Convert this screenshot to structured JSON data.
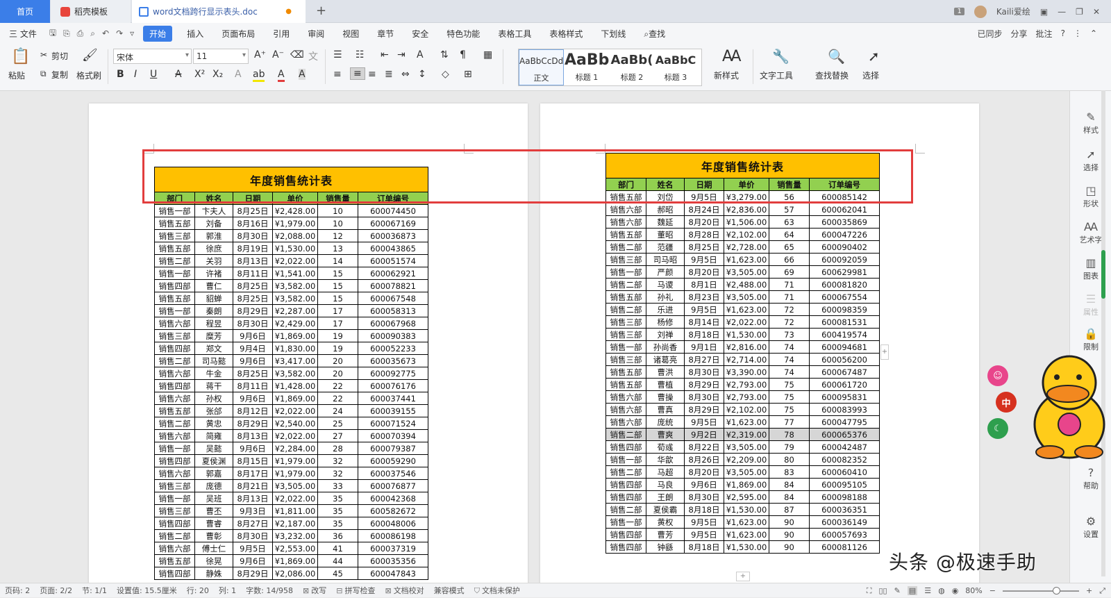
{
  "tabs": {
    "home": "首页",
    "templates": "稻壳模板",
    "doc": "word文档跨行显示表头.doc",
    "new_tab": "+",
    "badge": "1",
    "user": "Kaili爱绘"
  },
  "menu": {
    "file": "三 文件",
    "items": [
      "开始",
      "插入",
      "页面布局",
      "引用",
      "审阅",
      "视图",
      "章节",
      "安全",
      "特色功能",
      "表格工具",
      "表格样式",
      "下划线"
    ],
    "search": "查找",
    "right": [
      "已同步",
      "分享",
      "批注",
      "?"
    ]
  },
  "ribbon": {
    "paste": "粘贴",
    "cut": "剪切",
    "copy": "复制",
    "format_painter": "格式刷",
    "font_name": "宋体",
    "font_size": "11",
    "styles": [
      {
        "preview": "AaBbCcDd",
        "name": "正文"
      },
      {
        "preview": "AaBb",
        "name": "标题 1"
      },
      {
        "preview": "AaBb(",
        "name": "标题 2"
      },
      {
        "preview": "AaBbC",
        "name": "标题 3"
      }
    ],
    "new_style": "新样式",
    "text_tools": "文字工具",
    "find_replace": "查找替换",
    "select": "选择"
  },
  "right_panel": [
    "样式",
    "选择",
    "形状",
    "艺术字",
    "图表",
    "属性",
    "限制",
    "帮助",
    "设置"
  ],
  "table": {
    "title": "年度销售统计表",
    "headers": [
      "部门",
      "姓名",
      "日期",
      "单价",
      "销售量",
      "订单编号"
    ]
  },
  "left_rows": [
    [
      "销售一部",
      "卞夫人",
      "8月25日",
      "¥2,428.00",
      "10",
      "600074450"
    ],
    [
      "销售五部",
      "刘备",
      "8月16日",
      "¥1,979.00",
      "10",
      "600067169"
    ],
    [
      "销售三部",
      "郭淮",
      "8月30日",
      "¥2,088.00",
      "12",
      "600036873"
    ],
    [
      "销售五部",
      "徐庶",
      "8月19日",
      "¥1,530.00",
      "13",
      "600043865"
    ],
    [
      "销售二部",
      "关羽",
      "8月13日",
      "¥2,022.00",
      "14",
      "600051574"
    ],
    [
      "销售一部",
      "许褚",
      "8月11日",
      "¥1,541.00",
      "15",
      "600062921"
    ],
    [
      "销售四部",
      "曹仁",
      "8月25日",
      "¥3,582.00",
      "15",
      "600078821"
    ],
    [
      "销售五部",
      "貂蝉",
      "8月25日",
      "¥3,582.00",
      "15",
      "600067548"
    ],
    [
      "销售一部",
      "秦朗",
      "8月29日",
      "¥2,287.00",
      "17",
      "600058313"
    ],
    [
      "销售六部",
      "程昱",
      "8月30日",
      "¥2,429.00",
      "17",
      "600067968"
    ],
    [
      "销售三部",
      "糜芳",
      "9月6日",
      "¥1,869.00",
      "19",
      "600090383"
    ],
    [
      "销售四部",
      "郑文",
      "9月4日",
      "¥1,830.00",
      "19",
      "600052233"
    ],
    [
      "销售二部",
      "司马懿",
      "9月6日",
      "¥3,417.00",
      "20",
      "600035673"
    ],
    [
      "销售六部",
      "牛金",
      "8月25日",
      "¥3,582.00",
      "20",
      "600092775"
    ],
    [
      "销售四部",
      "蒋干",
      "8月11日",
      "¥1,428.00",
      "22",
      "600076176"
    ],
    [
      "销售六部",
      "孙权",
      "9月6日",
      "¥1,869.00",
      "22",
      "600037441"
    ],
    [
      "销售五部",
      "张郃",
      "8月12日",
      "¥2,022.00",
      "24",
      "600039155"
    ],
    [
      "销售二部",
      "黄忠",
      "8月29日",
      "¥2,540.00",
      "25",
      "600071524"
    ],
    [
      "销售六部",
      "简雍",
      "8月13日",
      "¥2,022.00",
      "27",
      "600070394"
    ],
    [
      "销售一部",
      "吴懿",
      "9月6日",
      "¥2,284.00",
      "28",
      "600079387"
    ],
    [
      "销售四部",
      "夏侯渊",
      "8月15日",
      "¥1,979.00",
      "32",
      "600059290"
    ],
    [
      "销售六部",
      "郭嘉",
      "8月17日",
      "¥1,979.00",
      "32",
      "600037546"
    ],
    [
      "销售三部",
      "庞德",
      "8月21日",
      "¥3,505.00",
      "33",
      "600076877"
    ],
    [
      "销售一部",
      "吴班",
      "8月13日",
      "¥2,022.00",
      "35",
      "600042368"
    ],
    [
      "销售三部",
      "曹丕",
      "9月3日",
      "¥1,811.00",
      "35",
      "600582672"
    ],
    [
      "销售四部",
      "曹睿",
      "8月27日",
      "¥2,187.00",
      "35",
      "600048006"
    ],
    [
      "销售二部",
      "曹彰",
      "8月30日",
      "¥3,232.00",
      "36",
      "600086198"
    ],
    [
      "销售六部",
      "傅士仁",
      "9月5日",
      "¥2,553.00",
      "41",
      "600037319"
    ],
    [
      "销售五部",
      "徐晃",
      "9月6日",
      "¥1,869.00",
      "44",
      "600035356"
    ],
    [
      "销售四部",
      "静姝",
      "8月29日",
      "¥2,086.00",
      "45",
      "600047843"
    ]
  ],
  "right_rows": [
    [
      "销售五部",
      "刘岱",
      "9月5日",
      "¥3,279.00",
      "56",
      "600085142"
    ],
    [
      "销售六部",
      "郝昭",
      "8月24日",
      "¥2,836.00",
      "57",
      "600062041"
    ],
    [
      "销售六部",
      "魏延",
      "8月20日",
      "¥1,506.00",
      "63",
      "600035869"
    ],
    [
      "销售五部",
      "董昭",
      "8月28日",
      "¥2,102.00",
      "64",
      "600047226"
    ],
    [
      "销售二部",
      "范疆",
      "8月25日",
      "¥2,728.00",
      "65",
      "600090402"
    ],
    [
      "销售三部",
      "司马昭",
      "9月5日",
      "¥1,623.00",
      "66",
      "600092059"
    ],
    [
      "销售一部",
      "严颜",
      "8月20日",
      "¥3,505.00",
      "69",
      "600629981"
    ],
    [
      "销售二部",
      "马谡",
      "8月1日",
      "¥2,488.00",
      "71",
      "600081820"
    ],
    [
      "销售五部",
      "孙礼",
      "8月23日",
      "¥3,505.00",
      "71",
      "600067554"
    ],
    [
      "销售二部",
      "乐进",
      "9月5日",
      "¥1,623.00",
      "72",
      "600098359"
    ],
    [
      "销售三部",
      "杨修",
      "8月14日",
      "¥2,022.00",
      "72",
      "600081531"
    ],
    [
      "销售三部",
      "刘禅",
      "8月18日",
      "¥1,530.00",
      "73",
      "600419574"
    ],
    [
      "销售一部",
      "孙尚香",
      "9月1日",
      "¥2,816.00",
      "74",
      "600094681"
    ],
    [
      "销售三部",
      "诸葛亮",
      "8月27日",
      "¥2,714.00",
      "74",
      "600056200"
    ],
    [
      "销售五部",
      "曹洪",
      "8月30日",
      "¥3,390.00",
      "74",
      "600067487"
    ],
    [
      "销售五部",
      "曹植",
      "8月29日",
      "¥2,793.00",
      "75",
      "600061720"
    ],
    [
      "销售六部",
      "曹操",
      "8月30日",
      "¥2,793.00",
      "75",
      "600095831"
    ],
    [
      "销售六部",
      "曹真",
      "8月29日",
      "¥2,102.00",
      "75",
      "600083993"
    ],
    [
      "销售六部",
      "庞统",
      "9月5日",
      "¥1,623.00",
      "77",
      "600047795"
    ],
    [
      "销售二部",
      "曹爽",
      "9月2日",
      "¥2,319.00",
      "78",
      "600065376"
    ],
    [
      "销售四部",
      "荀彧",
      "8月22日",
      "¥3,505.00",
      "79",
      "600042487"
    ],
    [
      "销售一部",
      "华歆",
      "8月26日",
      "¥2,209.00",
      "80",
      "600082352"
    ],
    [
      "销售二部",
      "马超",
      "8月20日",
      "¥3,505.00",
      "83",
      "600060410"
    ],
    [
      "销售四部",
      "马良",
      "9月6日",
      "¥1,869.00",
      "84",
      "600095105"
    ],
    [
      "销售四部",
      "王朗",
      "8月30日",
      "¥2,595.00",
      "84",
      "600098188"
    ],
    [
      "销售二部",
      "夏侯霸",
      "8月18日",
      "¥1,530.00",
      "87",
      "600036351"
    ],
    [
      "销售一部",
      "黄权",
      "9月5日",
      "¥1,623.00",
      "90",
      "600036149"
    ],
    [
      "销售四部",
      "曹芳",
      "9月5日",
      "¥1,623.00",
      "90",
      "600057693"
    ],
    [
      "销售四部",
      "钟繇",
      "8月18日",
      "¥1,530.00",
      "90",
      "600081126"
    ]
  ],
  "highlight_right_row": 19,
  "status": {
    "page_code": "页码: 2",
    "pages": "页面: 2/2",
    "section": "节: 1/1",
    "setting": "设置值: 15.5厘米",
    "row": "行: 20",
    "col": "列: 1",
    "words": "字数: 14/958",
    "revise": "改写",
    "spell": "拼写检查",
    "proof": "文档校对",
    "compat": "兼容模式",
    "protect": "文档未保护",
    "zoom": "80%"
  },
  "watermark": "头条 @极速手助",
  "float_buttons": [
    "中"
  ],
  "colors": {
    "accent": "#3b7ee8",
    "title_bg": "#ffc000",
    "header_bg": "#92d050",
    "redbox": "#e23d3d"
  }
}
